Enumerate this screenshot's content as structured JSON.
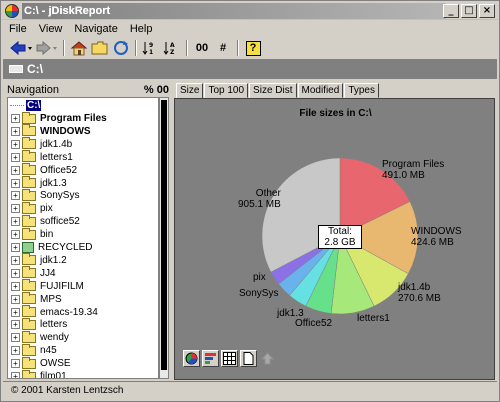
{
  "window": {
    "title": "C:\\ - jDiskReport",
    "minimize": "_",
    "maximize": "□",
    "close": "×"
  },
  "menu": [
    "File",
    "View",
    "Navigate",
    "Help"
  ],
  "toolbar": {
    "sort_hint": "00",
    "hash": "#",
    "help": "?"
  },
  "path": "C:\\",
  "navigation": {
    "header": "Navigation",
    "pct_label": "% 00",
    "root": "C:\\",
    "items": [
      {
        "label": "Program Files",
        "bold": true
      },
      {
        "label": "WINDOWS",
        "bold": true
      },
      {
        "label": "jdk1.4b"
      },
      {
        "label": "letters1"
      },
      {
        "label": "Office52"
      },
      {
        "label": "jdk1.3"
      },
      {
        "label": "SonySys"
      },
      {
        "label": "pix"
      },
      {
        "label": "soffice52"
      },
      {
        "label": "bin"
      },
      {
        "label": "RECYCLED"
      },
      {
        "label": "jdk1.2"
      },
      {
        "label": "JJ4"
      },
      {
        "label": "FUJIFILM"
      },
      {
        "label": "MPS"
      },
      {
        "label": "emacs-19.34"
      },
      {
        "label": "letters"
      },
      {
        "label": "wendy"
      },
      {
        "label": "n45"
      },
      {
        "label": "OWSE"
      },
      {
        "label": "film01"
      }
    ]
  },
  "tabs": [
    "Size",
    "Top 100",
    "Size Dist",
    "Modified",
    "Types"
  ],
  "chart_data": {
    "type": "pie",
    "title": "File sizes in C:\\",
    "total_label": "Total:",
    "total_value": "2.8 GB",
    "slices": [
      {
        "name": "Program Files",
        "value_mb": 491.0,
        "value_label": "491.0 MB",
        "color": "#e8666d"
      },
      {
        "name": "WINDOWS",
        "value_mb": 424.6,
        "value_label": "424.6 MB",
        "color": "#e9b870"
      },
      {
        "name": "jdk1.4b",
        "value_mb": 270.6,
        "value_label": "270.6 MB",
        "color": "#d8e86e"
      },
      {
        "name": "letters1",
        "value_mb": 250,
        "value_label": "",
        "color": "#a6e87a"
      },
      {
        "name": "Office52",
        "value_mb": 150,
        "value_label": "",
        "color": "#66e08a"
      },
      {
        "name": "jdk1.3",
        "value_mb": 110,
        "value_label": "",
        "color": "#66e0e2"
      },
      {
        "name": "SonySys",
        "value_mb": 90,
        "value_label": "",
        "color": "#6ab2ec"
      },
      {
        "name": "pix",
        "value_mb": 80,
        "value_label": "",
        "color": "#8c70e6"
      },
      {
        "name": "Other",
        "value_mb": 905.1,
        "value_label": "905.1 MB",
        "color": "#c8c8c8"
      }
    ]
  },
  "status": "© 2001 Karsten Lentzsch"
}
